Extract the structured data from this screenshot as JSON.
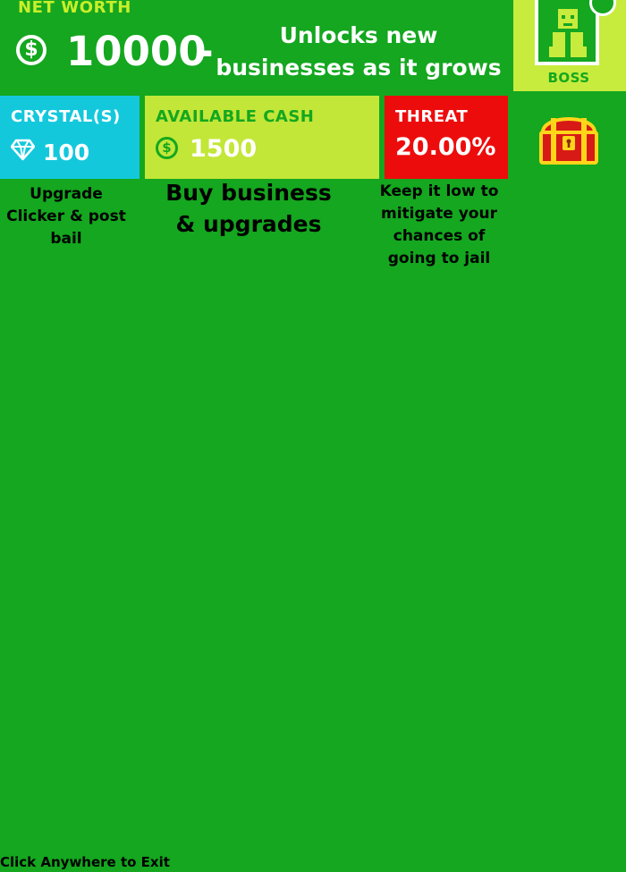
{
  "net_worth": {
    "title": "NET WORTH",
    "value": "10000",
    "dash": "-",
    "note": "Unlocks new businesses as it grows"
  },
  "boss": {
    "label": "BOSS"
  },
  "crystals": {
    "title": "CRYSTAL(S)",
    "value": "100",
    "hint": "Upgrade Clicker & post bail"
  },
  "cash": {
    "title": "AVAILABLE CASH",
    "value": "1500",
    "hint": "Buy business & upgrades"
  },
  "threat": {
    "title": "THREAT",
    "value": "20.00%",
    "hint": "Keep it low to mitigate your chances of going to jail"
  },
  "footer": {
    "exit": "Click Anywhere to Exit"
  },
  "icons": {
    "dollar": "dollar-coin-icon",
    "crystal": "diamond-icon",
    "boss": "boss-avatar-icon",
    "chest": "treasure-chest-icon"
  },
  "colors": {
    "background": "#14a71f",
    "crystal_panel": "#14c8dc",
    "cash_panel": "#c2e738",
    "threat_panel": "#ed0c0c"
  }
}
